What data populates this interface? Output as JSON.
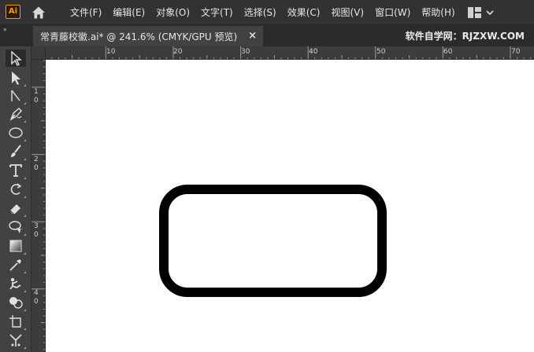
{
  "app": {
    "logo_text": "Ai",
    "logo_color": "#ff9a00"
  },
  "menu": {
    "items": [
      {
        "label": "文件(F)"
      },
      {
        "label": "编辑(E)"
      },
      {
        "label": "对象(O)"
      },
      {
        "label": "文字(T)"
      },
      {
        "label": "选择(S)"
      },
      {
        "label": "效果(C)"
      },
      {
        "label": "视图(V)"
      },
      {
        "label": "窗口(W)"
      },
      {
        "label": "帮助(H)"
      }
    ]
  },
  "tabs": {
    "collapse_glyph": "»",
    "document": {
      "title": "常青藤校徽.ai* @ 241.6% (CMYK/GPU 预览)",
      "close_glyph": "×"
    },
    "watermark": "软件自学网：RJZXW.COM"
  },
  "toolbar": {
    "tools": [
      {
        "name": "selection-tool",
        "icon": "selection-arrow-icon",
        "active": true
      },
      {
        "name": "direct-selection-tool",
        "icon": "direct-selection-icon"
      },
      {
        "name": "curvature-tool",
        "icon": "curvature-icon"
      },
      {
        "name": "pen-tool",
        "icon": "pen-icon"
      },
      {
        "name": "ellipse-tool",
        "icon": "ellipse-icon"
      },
      {
        "name": "paintbrush-tool",
        "icon": "paintbrush-icon"
      },
      {
        "name": "type-tool",
        "icon": "type-icon"
      },
      {
        "name": "rotate-tool",
        "icon": "rotate-icon"
      },
      {
        "name": "eraser-tool",
        "icon": "eraser-icon"
      },
      {
        "name": "lasso-tool",
        "icon": "lasso-icon"
      },
      {
        "name": "gradient-tool",
        "icon": "gradient-icon"
      },
      {
        "name": "eyedropper-tool",
        "icon": "eyedropper-icon"
      },
      {
        "name": "puppet-warp-tool",
        "icon": "puppet-warp-icon"
      },
      {
        "name": "shape-builder-tool",
        "icon": "shape-builder-icon"
      },
      {
        "name": "artboard-tool",
        "icon": "artboard-icon"
      },
      {
        "name": "symbol-sprayer-tool",
        "icon": "symbol-sprayer-icon"
      }
    ]
  },
  "rulers": {
    "horizontal_labels": [
      "10",
      "20",
      "30",
      "40",
      "50",
      "60",
      "70"
    ],
    "vertical_labels": [
      "1\n0",
      "2\n0",
      "3\n0",
      "4\n0"
    ]
  },
  "canvas": {
    "background": "#ffffff",
    "shape": {
      "type": "rounded-rectangle",
      "stroke": "#000000",
      "fill": "#ffffff"
    }
  }
}
